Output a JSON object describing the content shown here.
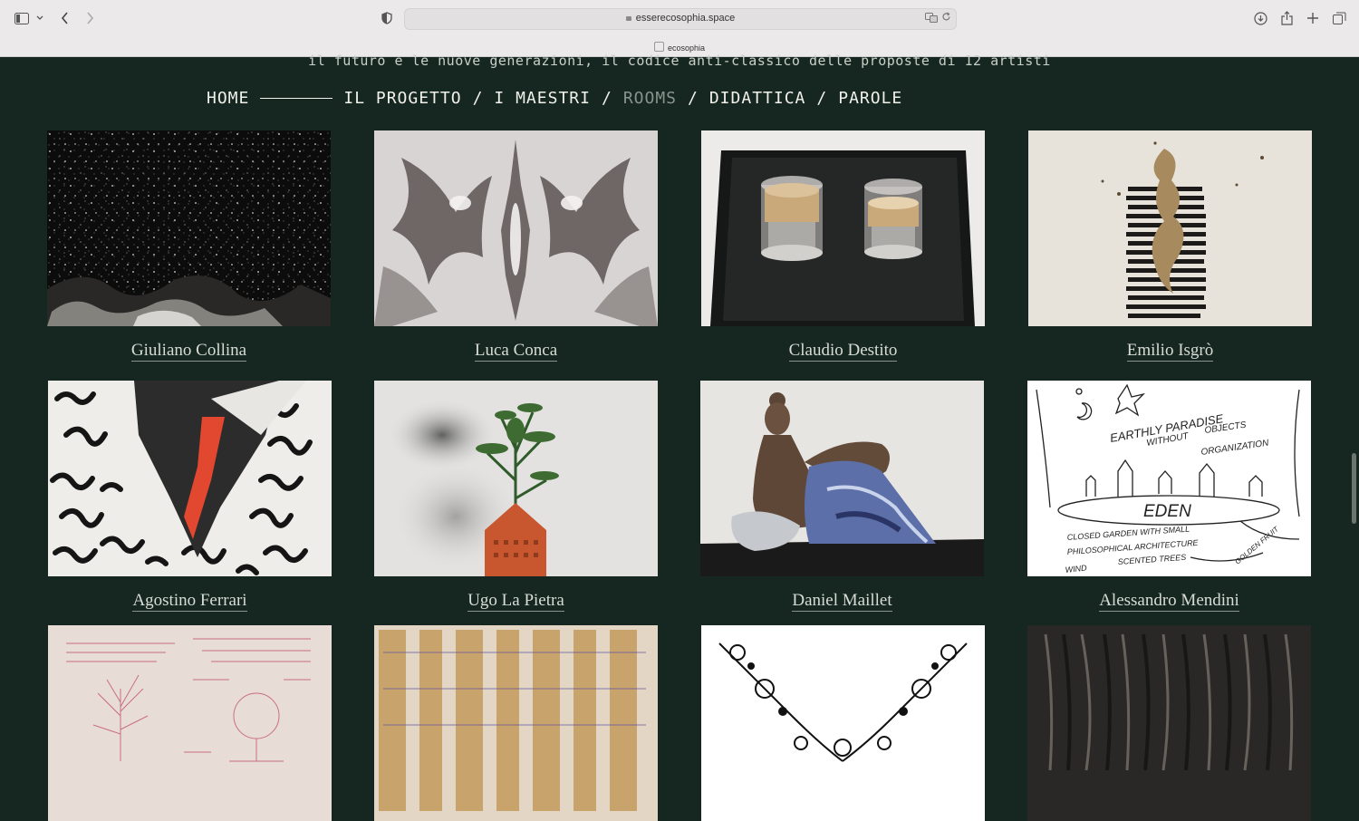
{
  "browser": {
    "url": "esserecosophia.space",
    "tab_title": "ecosophia",
    "icons": [
      "sidebar-icon",
      "chevron-down-icon",
      "back-icon",
      "forward-icon",
      "shield-icon",
      "lock-icon",
      "translate-icon",
      "reload-icon",
      "download-icon",
      "share-icon",
      "new-tab-icon",
      "tabs-overview-icon"
    ]
  },
  "page": {
    "subtitle": "il futuro e le nuove generazioni, il codice anti-classico delle proposte di 12 artisti",
    "nav": {
      "home": "HOME",
      "progetto": "IL PROGETTO",
      "maestri": "I MAESTRI",
      "rooms": "ROOMS",
      "didattica": "DIDATTICA",
      "parole": "PAROLE",
      "separator": "/"
    },
    "artists": [
      {
        "name": "Giuliano Collina"
      },
      {
        "name": "Luca Conca"
      },
      {
        "name": "Claudio Destito"
      },
      {
        "name": "Emilio Isgrò"
      },
      {
        "name": "Agostino Ferrari"
      },
      {
        "name": "Ugo La Pietra"
      },
      {
        "name": "Daniel Maillet"
      },
      {
        "name": "Alessandro Mendini"
      }
    ],
    "artwork_text": {
      "mendini_1": "EARTHLY PARADISE",
      "mendini_2": "WITHOUT",
      "mendini_3": "OBJECTS",
      "mendini_4": "ORGANIZATION",
      "mendini_5": "EDEN",
      "mendini_6": "CLOSED GARDEN WITH SMALL",
      "mendini_7": "PHILOSOPHICAL ARCHITECTURE",
      "mendini_8": "WIND",
      "mendini_9": "SCENTED TREES",
      "mendini_10": "GOLDEN FRUIT"
    },
    "colors": {
      "background": "#162620",
      "text": "#f1f1ec",
      "active_nav": "#8b938f"
    }
  }
}
